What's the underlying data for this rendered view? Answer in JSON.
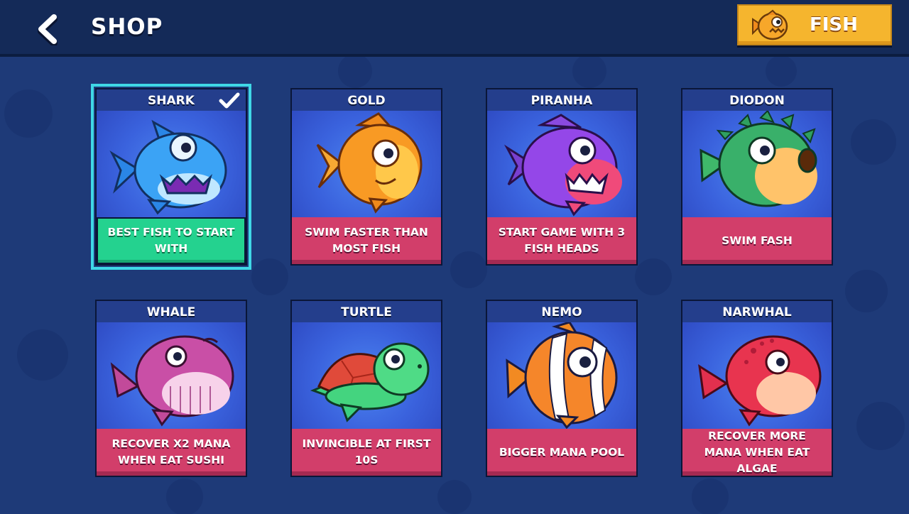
{
  "header": {
    "back_icon": "chevron-left-icon",
    "title": "SHOP",
    "currency_label": "FISH",
    "currency_icon": "piranha-icon"
  },
  "colors": {
    "background": "#1e3a78",
    "topbar": "#142a58",
    "card_desc": "#d23e6a",
    "selected_desc": "#24d28f",
    "selected_outline": "#3fd7e6",
    "accent_button": "#f5b52e"
  },
  "cards": [
    {
      "name": "SHARK",
      "description": "BEST FISH TO START WITH",
      "selected": true,
      "icon": "shark-icon"
    },
    {
      "name": "GOLD",
      "description": "SWIM FASTER THAN MOST FISH",
      "selected": false,
      "icon": "goldfish-icon"
    },
    {
      "name": "PIRANHA",
      "description": "START GAME WITH 3 FISH HEADS",
      "selected": false,
      "icon": "piranha-icon"
    },
    {
      "name": "DIODON",
      "description": "SWIM FASH",
      "selected": false,
      "icon": "pufferfish-icon"
    },
    {
      "name": "WHALE",
      "description": "RECOVER X2 MANA WHEN EAT SUSHI",
      "selected": false,
      "icon": "whale-icon"
    },
    {
      "name": "TURTLE",
      "description": "INVINCIBLE AT FIRST 10S",
      "selected": false,
      "icon": "turtle-icon"
    },
    {
      "name": "NEMO",
      "description": "BIGGER MANA POOL",
      "selected": false,
      "icon": "clownfish-icon"
    },
    {
      "name": "NARWHAL",
      "description": "RECOVER MORE MANA WHEN EAT ALGAE",
      "selected": false,
      "icon": "narwhal-icon"
    }
  ]
}
